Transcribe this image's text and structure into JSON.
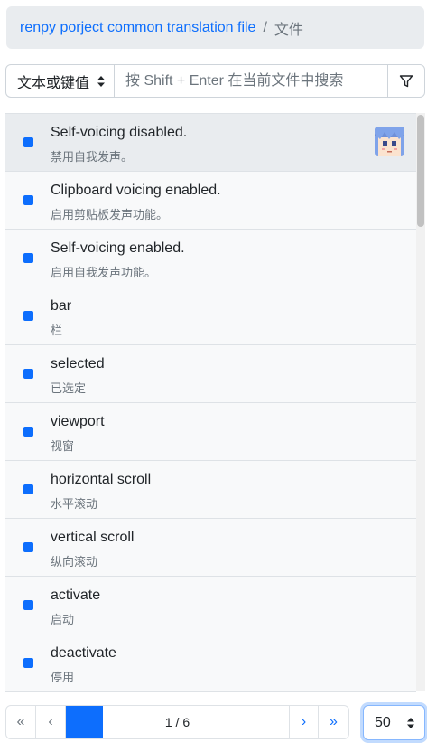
{
  "breadcrumb": {
    "project": "renpy porject common translation file",
    "current": "文件"
  },
  "search": {
    "mode": "文本或键值",
    "placeholder": "按 Shift + Enter 在当前文件中搜索"
  },
  "entries": [
    {
      "source": "Self-voicing disabled.",
      "target": "禁用自我发声。"
    },
    {
      "source": "Clipboard voicing enabled.",
      "target": "启用剪贴板发声功能。"
    },
    {
      "source": "Self-voicing enabled.",
      "target": "启用自我发声功能。"
    },
    {
      "source": "bar",
      "target": "栏"
    },
    {
      "source": "selected",
      "target": "已选定"
    },
    {
      "source": "viewport",
      "target": "视窗"
    },
    {
      "source": "horizontal scroll",
      "target": "水平滚动"
    },
    {
      "source": "vertical scroll",
      "target": "纵向滚动"
    },
    {
      "source": "activate",
      "target": "启动"
    },
    {
      "source": "deactivate",
      "target": "停用"
    }
  ],
  "pagination": {
    "first": "«",
    "prev": "‹",
    "page_label": "1 / 6",
    "current_page": 1,
    "total_pages": 6,
    "next": "›",
    "last": "»",
    "page_size": "50"
  },
  "colors": {
    "accent": "#0d6efd",
    "status_dot": "#0d6efd"
  },
  "icons": {
    "filter": "filter-icon",
    "sort": "sort-icon",
    "avatar": "avatar"
  }
}
